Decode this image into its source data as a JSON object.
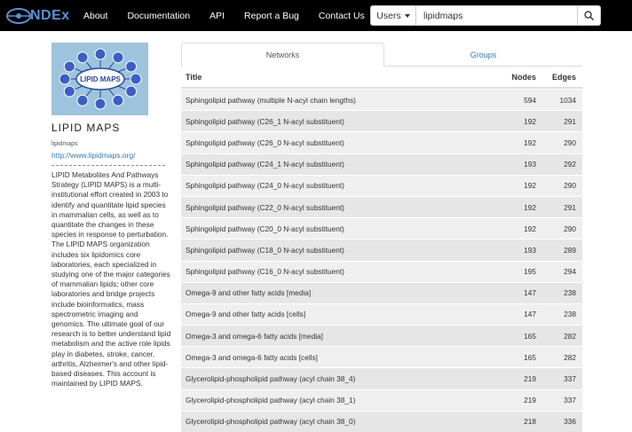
{
  "brand": {
    "name": "NDEx"
  },
  "nav": {
    "links": [
      "About",
      "Documentation",
      "API",
      "Report a Bug",
      "Contact Us"
    ]
  },
  "search": {
    "scope_label": "Users",
    "query": "lipidmaps"
  },
  "icons": {
    "logo": "ndex-logo",
    "search": "search-icon",
    "caret": "caret-down-icon",
    "profile": "lipid-maps-logo"
  },
  "colors": {
    "brand": "#5b8fd6",
    "link": "#337ab7",
    "navbar": "#000000"
  },
  "profile": {
    "logo_text": "LIPID MAPS",
    "title": "LIPID MAPS",
    "handle": "lipidmaps",
    "url": "http://www.lipidmaps.org/",
    "description": "LIPID Metabolites And Pathways Strategy (LIPID MAPS) is a multi-institutional effort created in 2003 to identify and quantitate lipid species in mammalian cells, as well as to quantitate the changes in these species in response to perturbation. The LIPID MAPS organization includes six lipidomics core laboratories, each specialized in studying one of the major categories of mammalian lipids; other core laboratories and bridge projects include bioinformatics, mass spectrometric imaging and genomics. The ultimate goal of our research is to better understand lipid metabolism and the active role lipids play in diabetes, stroke, cancer, arthritis, Alzheimer's and other lipid-based diseases. This account is maintained by LIPID MAPS."
  },
  "tabs": {
    "networks": "Networks",
    "groups": "Groups"
  },
  "table": {
    "headers": {
      "title": "Title",
      "nodes": "Nodes",
      "edges": "Edges"
    },
    "rows": [
      {
        "title": "Sphingolipid pathway (multiple N-acyl chain lengths)",
        "nodes": "594",
        "edges": "1034"
      },
      {
        "title": "Sphingolipid pathway (C26_1 N-acyl substituent)",
        "nodes": "192",
        "edges": "291"
      },
      {
        "title": "Sphingolipid pathway (C26_0 N-acyl substituent)",
        "nodes": "192",
        "edges": "290"
      },
      {
        "title": "Sphingolipid pathway (C24_1 N-acyl substituent)",
        "nodes": "193",
        "edges": "292"
      },
      {
        "title": "Sphingolipid pathway (C24_0 N-acyl substituent)",
        "nodes": "192",
        "edges": "290"
      },
      {
        "title": "Sphingolipid pathway (C22_0 N-acyl substituent)",
        "nodes": "192",
        "edges": "291"
      },
      {
        "title": "Sphingolipid pathway (C20_0 N-acyl substituent)",
        "nodes": "192",
        "edges": "290"
      },
      {
        "title": "Sphingolipid pathway (C18_0 N-acyl substituent)",
        "nodes": "193",
        "edges": "289"
      },
      {
        "title": "Sphingolipid pathway (C16_0 N-acyl substituent)",
        "nodes": "195",
        "edges": "294"
      },
      {
        "title": "Omega-9 and other fatty acids [media]",
        "nodes": "147",
        "edges": "238"
      },
      {
        "title": "Omega-9 and other fatty acids [cells]",
        "nodes": "147",
        "edges": "238"
      },
      {
        "title": "Omega-3 and omega-6 fatty acids [media]",
        "nodes": "165",
        "edges": "282"
      },
      {
        "title": "Omega-3 and omega-6 fatty acids [cells]",
        "nodes": "165",
        "edges": "282"
      },
      {
        "title": "Glycerolipid-phospholipid pathway (acyl chain 38_4)",
        "nodes": "219",
        "edges": "337"
      },
      {
        "title": "Glycerolipid-phospholipid pathway (acyl chain 38_1)",
        "nodes": "219",
        "edges": "337"
      },
      {
        "title": "Glycerolipid-phospholipid pathway (acyl chain 38_0)",
        "nodes": "218",
        "edges": "336"
      }
    ]
  }
}
